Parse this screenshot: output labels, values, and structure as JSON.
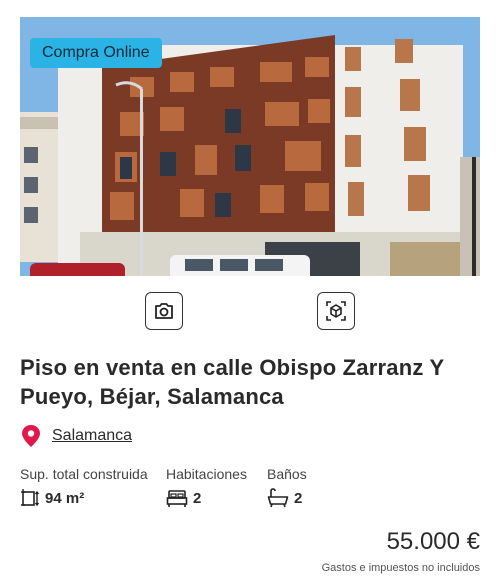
{
  "listing": {
    "badge": "Compra Online",
    "title": "Piso en venta en calle Obispo Zarranz Y Pueyo, Béjar, Salamanca",
    "location": "Salamanca",
    "features": {
      "area": {
        "label": "Sup. total construida",
        "value": "94 m²"
      },
      "rooms": {
        "label": "Habitaciones",
        "value": "2"
      },
      "baths": {
        "label": "Baños",
        "value": "2"
      }
    },
    "price": "55.000 €",
    "price_note": "Gastos e impuestos no incluidos"
  },
  "icons": {
    "gallery": "camera-icon",
    "virtual_tour": "cube-3d-icon",
    "location": "map-pin-icon",
    "area": "area-measure-icon",
    "rooms": "bed-icon",
    "baths": "bathtub-icon"
  },
  "colors": {
    "badge_bg": "#2bb3e6",
    "pin": "#e0194a",
    "text": "#2a2a2a"
  }
}
